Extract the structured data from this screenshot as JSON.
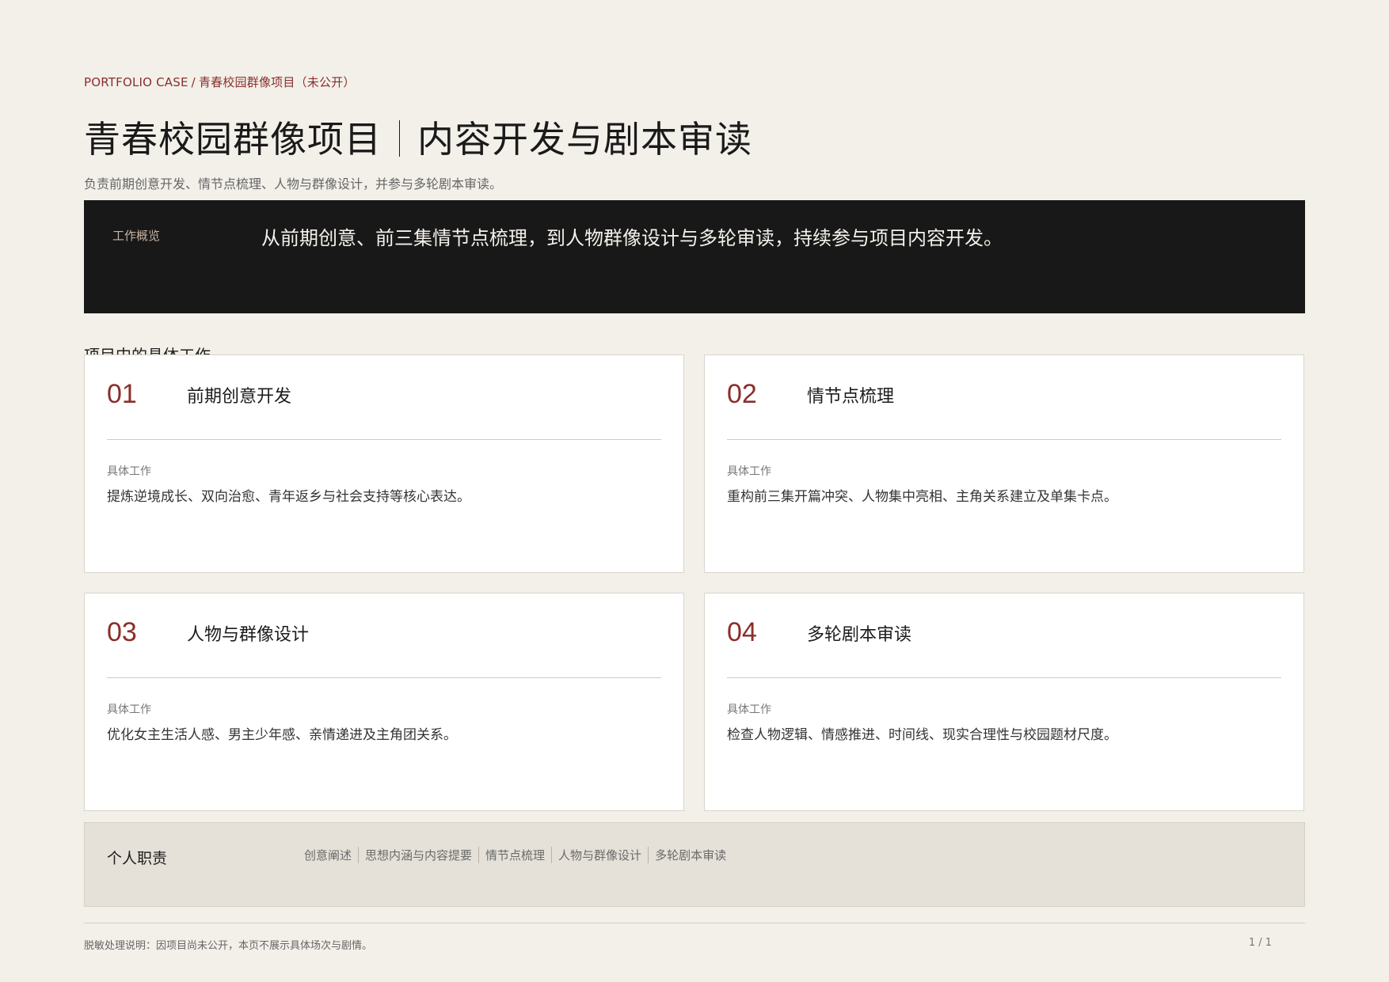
{
  "breadcrumb": {
    "prefix": "PORTFOLIO CASE",
    "separator": "/",
    "current": "青春校园群像项目（未公开）"
  },
  "title": {
    "main": "青春校园群像项目",
    "sub": "内容开发与剧本审读"
  },
  "subtitle": "负责前期创意开发、情节点梳理、人物与群像设计，并参与多轮剧本审读。",
  "overview": {
    "label": "工作概览",
    "text": "从前期创意、前三集情节点梳理，到人物群像设计与多轮审读，持续参与项目内容开发。"
  },
  "section_heading": "项目中的具体工作",
  "cards": [
    {
      "num": "01",
      "title": "前期创意开发",
      "label": "具体工作",
      "text": "提炼逆境成长、双向治愈、青年返乡与社会支持等核心表达。"
    },
    {
      "num": "02",
      "title": "情节点梳理",
      "label": "具体工作",
      "text": "重构前三集开篇冲突、人物集中亮相、主角关系建立及单集卡点。"
    },
    {
      "num": "03",
      "title": "人物与群像设计",
      "label": "具体工作",
      "text": "优化女主生活人感、男主少年感、亲情递进及主角团关系。"
    },
    {
      "num": "04",
      "title": "多轮剧本审读",
      "label": "具体工作",
      "text": "检查人物逻辑、情感推进、时间线、现实合理性与校园题材尺度。"
    }
  ],
  "duties": {
    "label": "个人职责",
    "tags": [
      "创意阐述",
      "思想内涵与内容提要",
      "情节点梳理",
      "人物与群像设计",
      "多轮剧本审读"
    ]
  },
  "footnote": "脱敏处理说明：因项目尚未公开，本页不展示具体场次与剧情。",
  "page": "1 / 1",
  "colors": {
    "accent": "#8a2e2b",
    "background": "#f3f0ea",
    "overview_bg": "#181818",
    "duties_bg": "#e5e1d8"
  }
}
